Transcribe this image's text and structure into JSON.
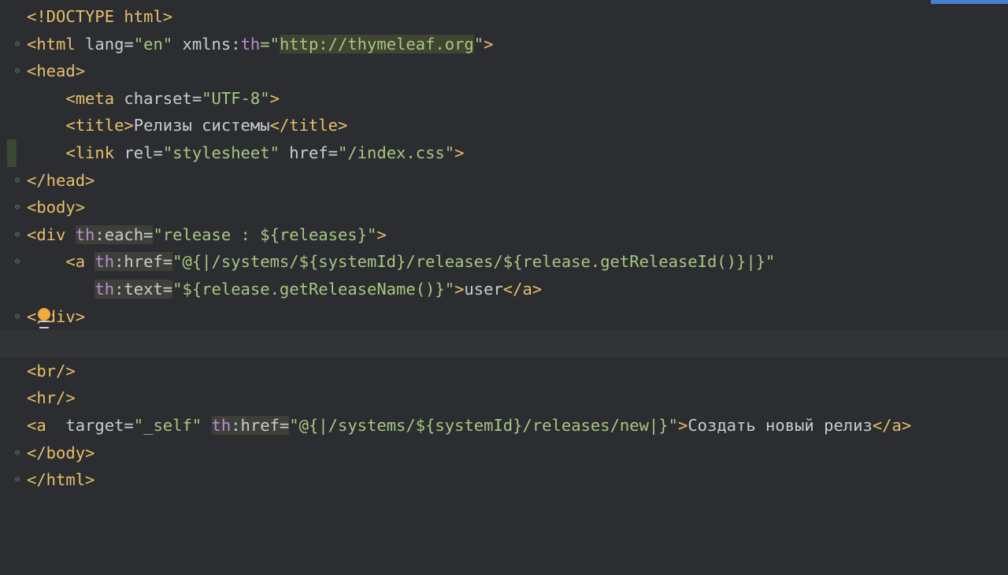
{
  "accent_color": "#4a7fd0",
  "lines": {
    "l1": "<!DOCTYPE html>",
    "l2a": "<html",
    "l2b": " lang=",
    "l2c": "\"en\"",
    "l2d": " xmlns:",
    "l2e": "th",
    "l2f": "=\"",
    "l2g": "http://thymeleaf.org",
    "l2h": "\"",
    "l2i": ">",
    "l3": "<head>",
    "l4a": "    <meta",
    "l4b": " charset=",
    "l4c": "\"UTF-8\"",
    "l4d": ">",
    "l5a": "    <title>",
    "l5b": "Релизы системы",
    "l5c": "</title>",
    "l6a": "    <link",
    "l6b": " rel=",
    "l6c": "\"stylesheet\"",
    "l6d": " href=",
    "l6e": "\"/index.css\"",
    "l6f": ">",
    "l7": "</head>",
    "l8": "<body>",
    "l9a": "<div ",
    "l9b": "th",
    "l9c": ":each=",
    "l9d": "\"release : ${releases}\"",
    "l9e": ">",
    "l10a": "    <a ",
    "l10b": "th",
    "l10c": ":href=",
    "l10d": "\"@{|/systems/${systemId}/releases/${release.getReleaseId()}|}\"",
    "l11a": "       ",
    "l11b": "th",
    "l11c": ":text=",
    "l11d": "\"${release.getReleaseName()}\"",
    "l11e": ">",
    "l11f": "user",
    "l11g": "</a>",
    "l12a": "<",
    "l12b": "/div>",
    "l13": "",
    "l14": "<br/>",
    "l15": "<hr/>",
    "l16a": "<a",
    "l16b": "  target=",
    "l16c": "\"_self\"",
    "l16d": " ",
    "l16e": "th",
    "l16f": ":href=",
    "l16g": "\"@{|/systems/${systemId}/releases/new|}\"",
    "l16h": ">",
    "l16i": "Создать новый релиз",
    "l16j": "</a>",
    "l17": "</body>",
    "l18": "</html>"
  }
}
